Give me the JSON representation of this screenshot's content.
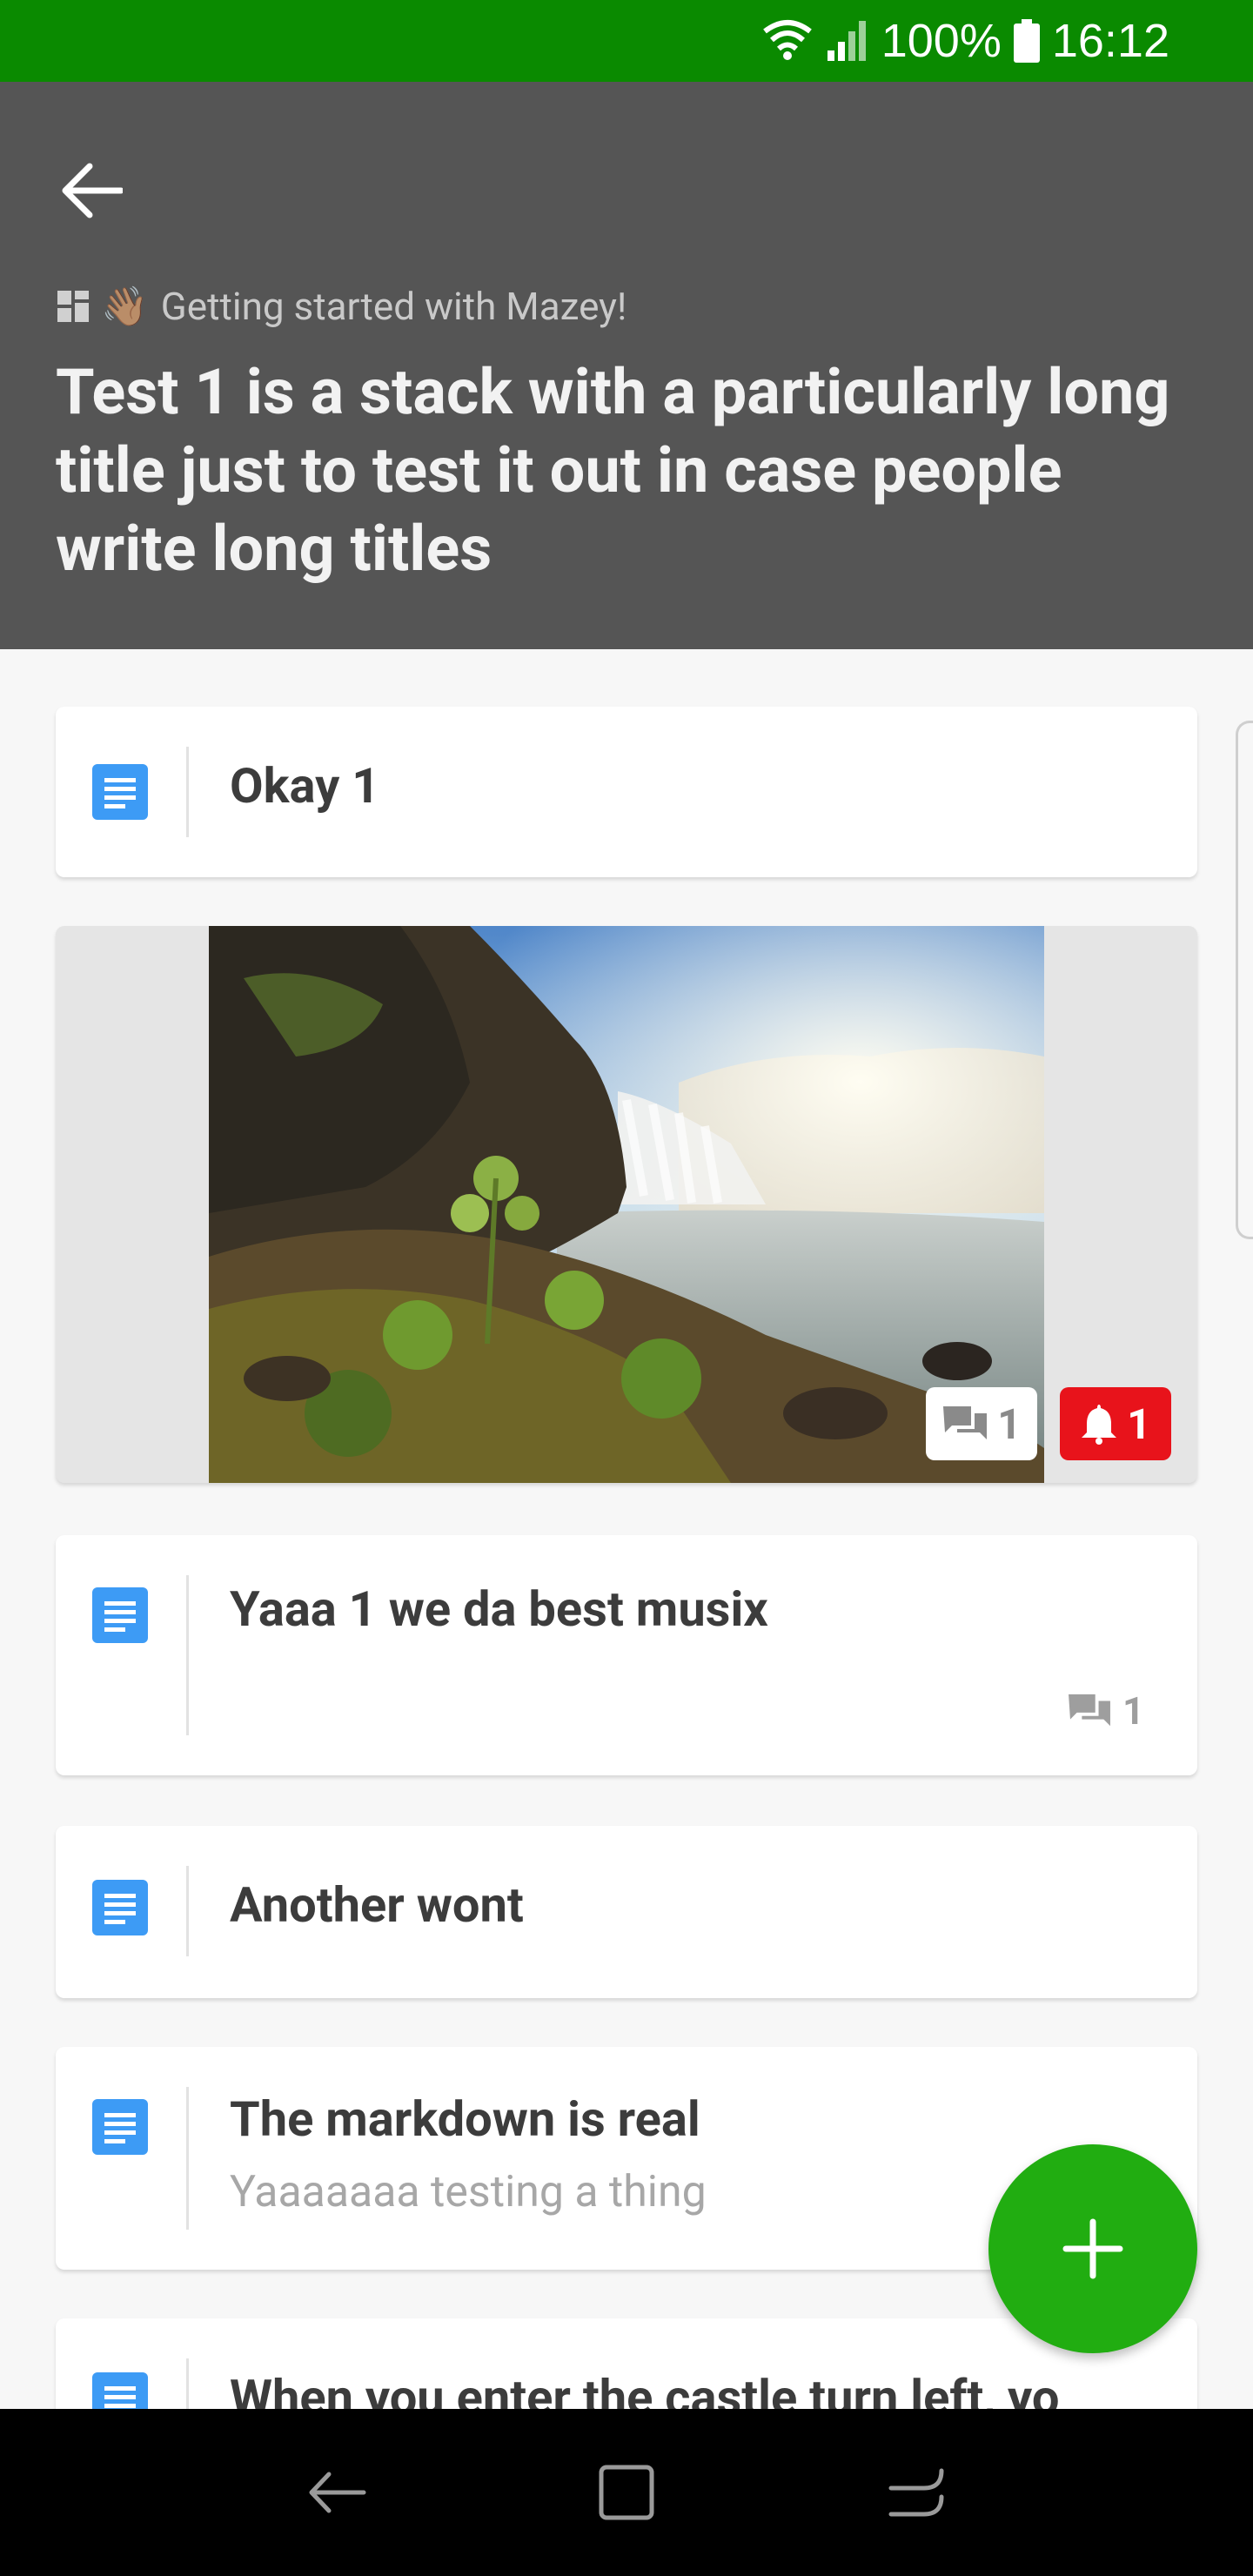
{
  "status_bar": {
    "battery": "100%",
    "time": "16:12"
  },
  "header": {
    "breadcrumb": "Getting started with Mazey!",
    "breadcrumb_emoji": "👋🏽",
    "title": "Test 1 is a stack with a particularly long title just to test it out in case people write long titles"
  },
  "cards": [
    {
      "title": "Okay 1"
    },
    {
      "type": "image",
      "comments": "1",
      "alerts": "1"
    },
    {
      "title": "Yaaa 1 we da best musix",
      "comments": "1"
    },
    {
      "title": "Another wont"
    },
    {
      "title": "The markdown is real",
      "subtitle": "Yaaaaaaa testing a thing"
    },
    {
      "title": "When you enter the castle turn left, yo"
    }
  ],
  "colors": {
    "status_bar": "#0a8a00",
    "header": "#555555",
    "accent_green": "#21ad11",
    "doc_icon": "#3d9bf5",
    "alert_red": "#e8131b"
  }
}
